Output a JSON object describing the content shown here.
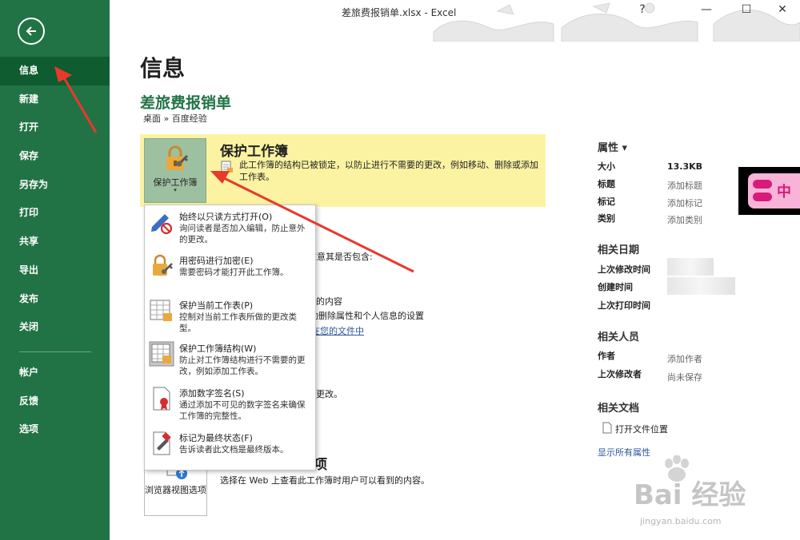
{
  "window": {
    "title": "差旅费报销单.xlsx  -  Excel",
    "minimize": "—",
    "maximize": "☐",
    "close": "✕",
    "help": "?"
  },
  "sidebar": {
    "items": [
      {
        "label": "信息"
      },
      {
        "label": "新建"
      },
      {
        "label": "打开"
      },
      {
        "label": "保存"
      },
      {
        "label": "另存为"
      },
      {
        "label": "打印"
      },
      {
        "label": "共享"
      },
      {
        "label": "导出"
      },
      {
        "label": "发布"
      },
      {
        "label": "关闭"
      }
    ],
    "lower_items": [
      {
        "label": "帐户"
      },
      {
        "label": "反馈"
      },
      {
        "label": "选项"
      }
    ]
  },
  "main": {
    "page_title": "信息",
    "workbook_name": "差旅费报销单",
    "breadcrumb": "桌面 » 百度经验",
    "protect": {
      "button_label": "保护工作簿",
      "caret": "▾",
      "title": "保护工作簿",
      "description": "此工作簿的结构已被锁定，以防止进行不需要的更改，例如移动、删除或添加工作表。"
    },
    "background": {
      "frag1": "注意其是否包含:",
      "frag2": "的内容",
      "frag3": "动删除属性和个人信息的设置",
      "frag4_link": "在您的文件中",
      "frag5": "更改。",
      "frag6": "项"
    },
    "browser": {
      "button_label": "浏览器视图选项",
      "description": "选择在 Web 上查看此工作簿时用户可以看到的内容。"
    }
  },
  "dropdown": {
    "items": [
      {
        "title": "始终以只读方式打开(O)",
        "description": "询问读者是否加入编辑，防止意外的更改。"
      },
      {
        "title": "用密码进行加密(E)",
        "description": "需要密码才能打开此工作簿。"
      },
      {
        "title": "保护当前工作表(P)",
        "description": "控制对当前工作表所做的更改类型。"
      },
      {
        "title": "保护工作簿结构(W)",
        "description": "防止对工作簿结构进行不需要的更改，例如添加工作表。"
      },
      {
        "title": "添加数字签名(S)",
        "description": "通过添加不可见的数字签名来确保工作簿的完整性。"
      },
      {
        "title": "标记为最终状态(F)",
        "description": "告诉读者此文档是最终版本。"
      }
    ]
  },
  "properties": {
    "header": "属性 ▾",
    "rows": [
      {
        "label": "大小",
        "value": "13.3KB"
      },
      {
        "label": "标题",
        "value": "添加标题"
      },
      {
        "label": "标记",
        "value": "添加标记"
      },
      {
        "label": "类别",
        "value": "添加类别"
      }
    ],
    "dates_header": "相关日期",
    "dates": [
      {
        "label": "上次修改时间"
      },
      {
        "label": "创建时间"
      },
      {
        "label": "上次打印时间"
      }
    ],
    "people_header": "相关人员",
    "people": [
      {
        "label": "作者",
        "value": "添加作者"
      },
      {
        "label": "上次修改者",
        "value": "尚未保存"
      }
    ],
    "docs_header": "相关文档",
    "open_location": "打开文件位置",
    "show_all": "显示所有属性"
  },
  "badge_text": "中",
  "watermark": {
    "text": "Bai 经验",
    "sub": "jingyan.baidu.com"
  },
  "colors": {
    "excel_green": "#217346",
    "active_nav": "#0e5c2f",
    "warning_yellow": "#fbf3a2",
    "arrow_red": "#e8392c",
    "link_blue": "#2b579a"
  }
}
